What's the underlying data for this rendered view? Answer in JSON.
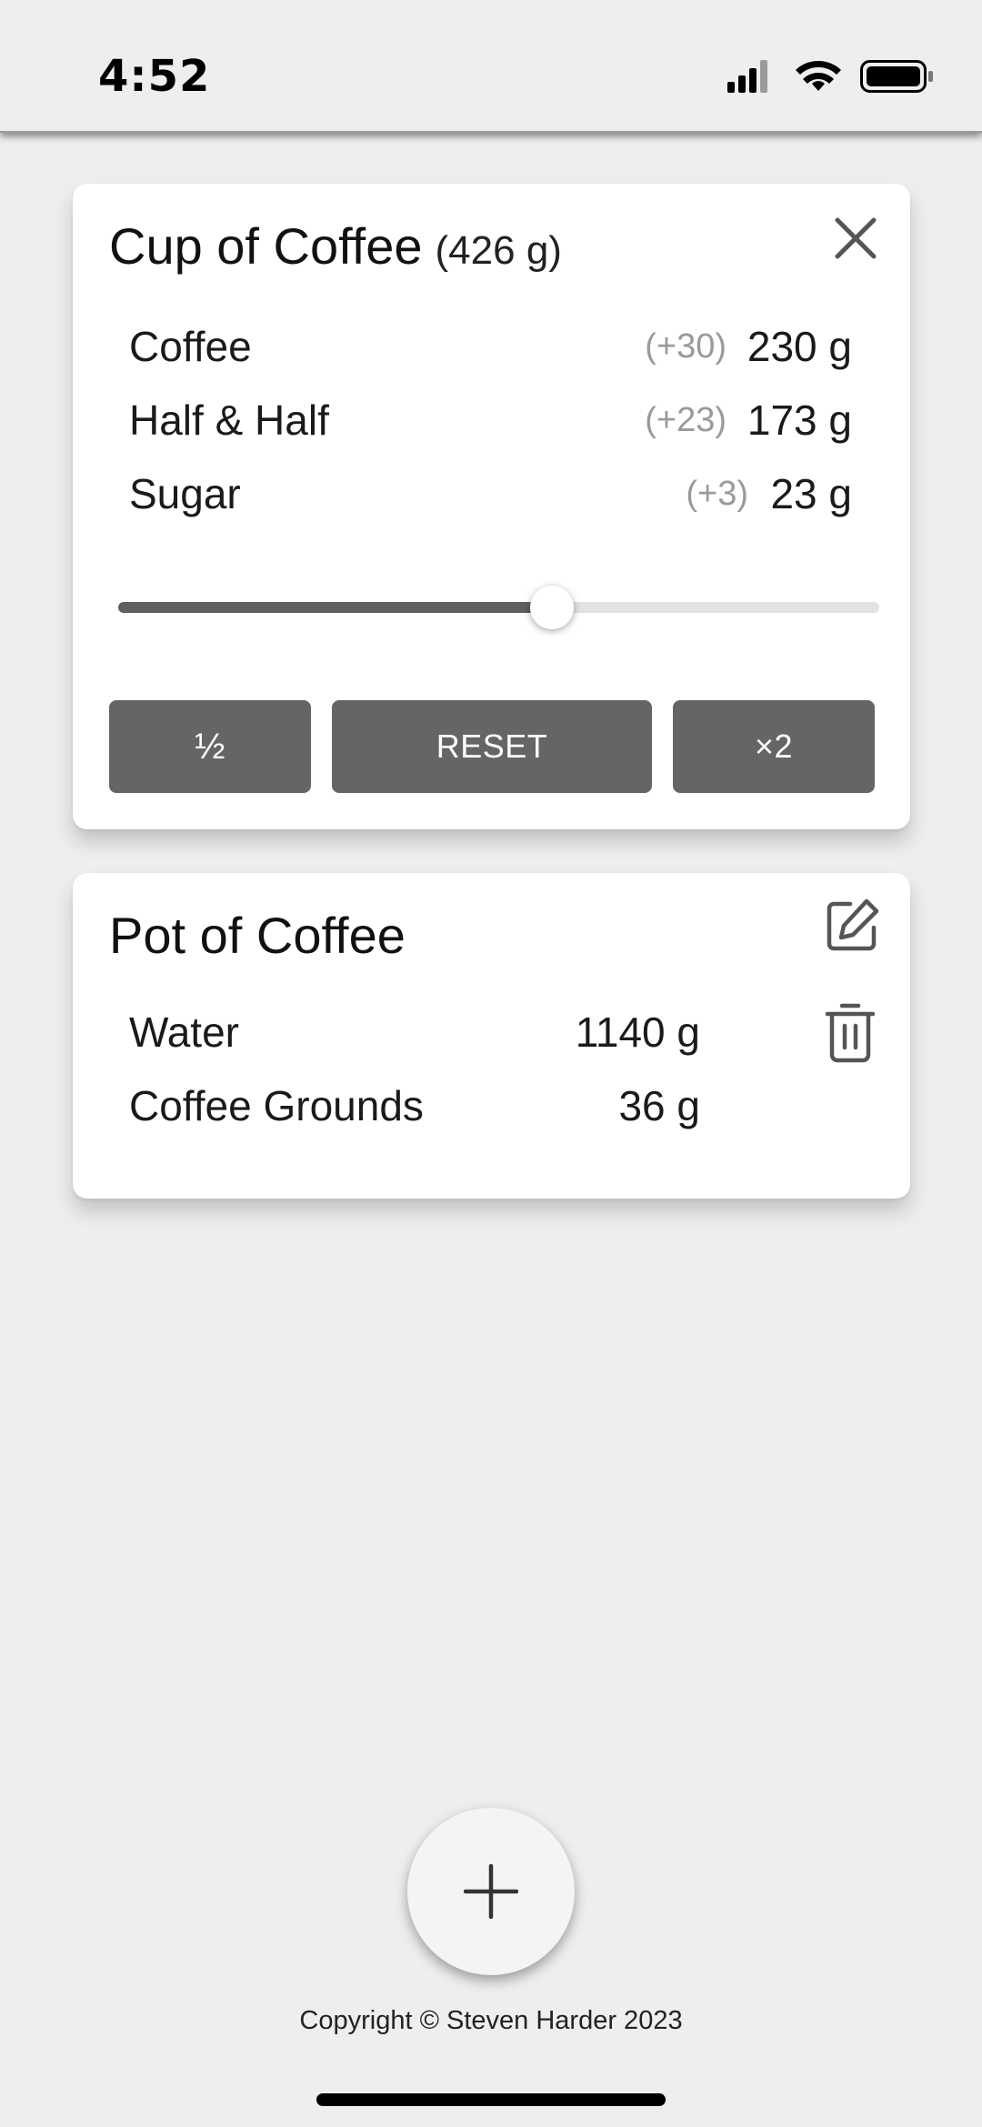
{
  "status_bar": {
    "time": "4:52",
    "icons": [
      "cellular-signal-icon",
      "wifi-icon",
      "battery-icon"
    ]
  },
  "cup_card": {
    "title": "Cup of Coffee",
    "total_weight": "(426 g)",
    "ingredients": [
      {
        "name": "Coffee",
        "delta": "(+30)",
        "amount": "230 g"
      },
      {
        "name": "Half & Half",
        "delta": "(+23)",
        "amount": "173 g"
      },
      {
        "name": "Sugar",
        "delta": "(+3)",
        "amount": "23 g"
      }
    ],
    "scale_slider": {
      "level": 0.57
    },
    "buttons": {
      "half": "½",
      "reset": "RESET",
      "double": "×2"
    }
  },
  "pot_card": {
    "title": "Pot of Coffee",
    "ingredients": [
      {
        "name": "Water",
        "amount": "1140 g"
      },
      {
        "name": "Coffee Grounds",
        "amount": "36 g"
      }
    ]
  },
  "footer": {
    "copyright": "Copyright © Steven Harder 2023"
  },
  "colors": {
    "background": "#eeeeee",
    "card": "#ffffff",
    "button": "#656565",
    "delta_text": "#9a9a9a"
  }
}
